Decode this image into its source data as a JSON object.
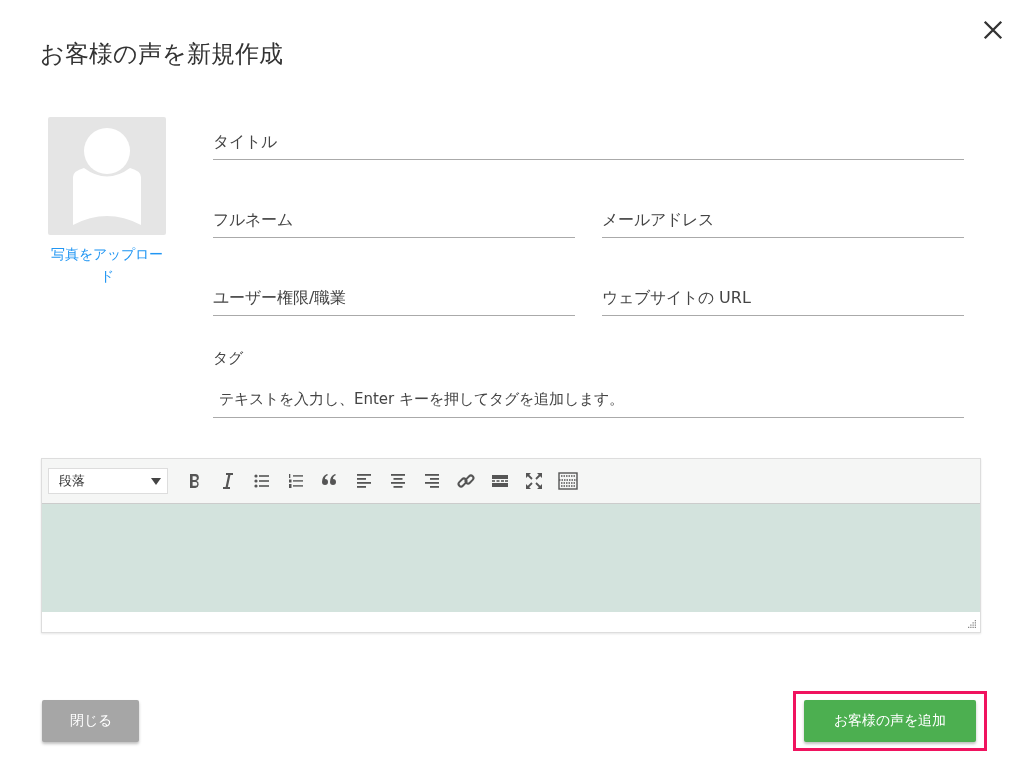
{
  "dialog": {
    "title": "お客様の声を新規作成"
  },
  "photo": {
    "upload_link": "写真をアップロード"
  },
  "fields": [
    {
      "placeholder": "タイトル",
      "kind": "wide"
    },
    {
      "placeholder": "フルネーム",
      "kind": "narrow"
    },
    {
      "placeholder": "メールアドレス",
      "kind": "narrow"
    },
    {
      "placeholder": "ユーザー権限/職業",
      "kind": "narrow"
    },
    {
      "placeholder": "ウェブサイトの URL",
      "kind": "narrow"
    }
  ],
  "tags": {
    "label": "タグ",
    "placeholder": "テキストを入力し、Enter キーを押してタグを追加します。"
  },
  "editor": {
    "format": "段落"
  },
  "buttons": [
    {
      "label": "閉じる",
      "kind": "secondary",
      "highlighted": false
    },
    {
      "label": "お客様の声を追加",
      "kind": "primary",
      "highlighted": true
    }
  ]
}
